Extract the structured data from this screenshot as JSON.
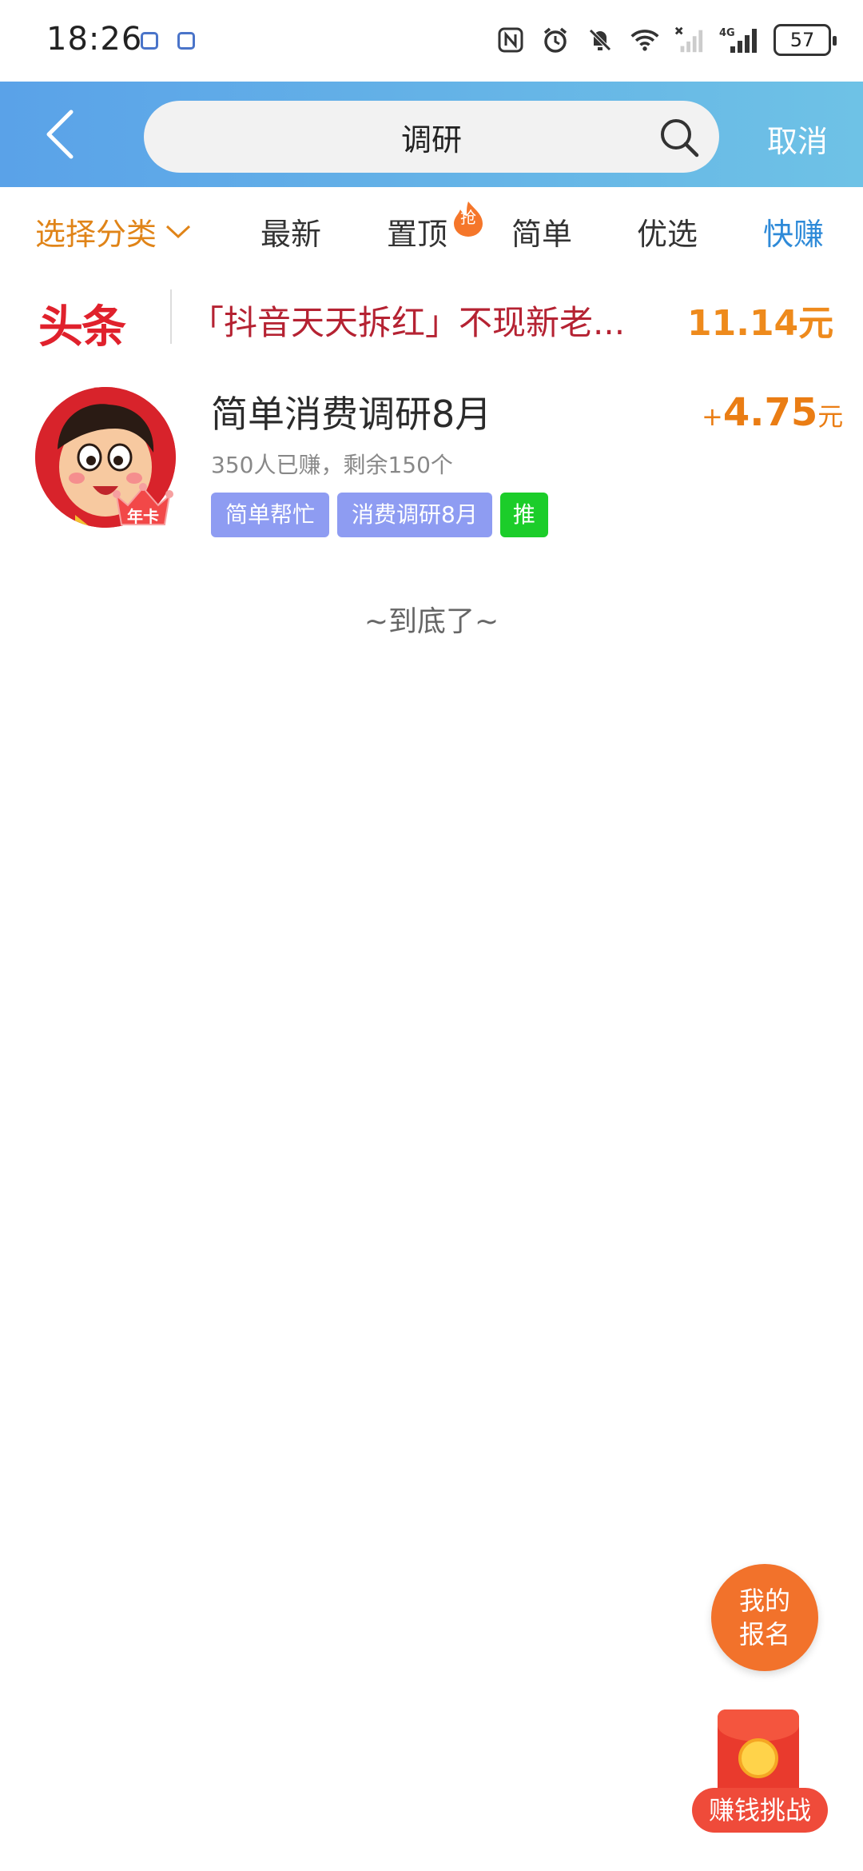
{
  "status_bar": {
    "time": "18:26",
    "battery": "57",
    "icons": [
      "nfc-icon",
      "alarm-icon",
      "mute-icon",
      "wifi-icon",
      "signal-off-icon",
      "signal-4g-icon"
    ]
  },
  "header": {
    "search_value": "调研",
    "cancel_label": "取消",
    "colors": {
      "gradient_start": "#5aa2e8",
      "gradient_end": "#6ec2e6"
    }
  },
  "tabs": {
    "select_category": "选择分类",
    "newest": "最新",
    "pinned": "置顶",
    "pinned_badge": "抢",
    "simple": "简单",
    "preferred": "优选",
    "quick_earn": "快赚"
  },
  "headline": {
    "logo": "头条",
    "text": "「抖音天天拆红」不现新老...",
    "price": "11.14元"
  },
  "task": {
    "title": "简单消费调研8月",
    "meta": "350人已赚，剩余150个",
    "badge": "年卡",
    "reward_plus": "+",
    "reward_amount": "4.75",
    "reward_unit": "元",
    "tags": [
      "简单帮忙",
      "消费调研8月",
      "推"
    ]
  },
  "end_text": "~到底了~",
  "floating": {
    "my_signup_line1": "我的",
    "my_signup_line2": "报名",
    "challenge": "赚钱挑战"
  }
}
